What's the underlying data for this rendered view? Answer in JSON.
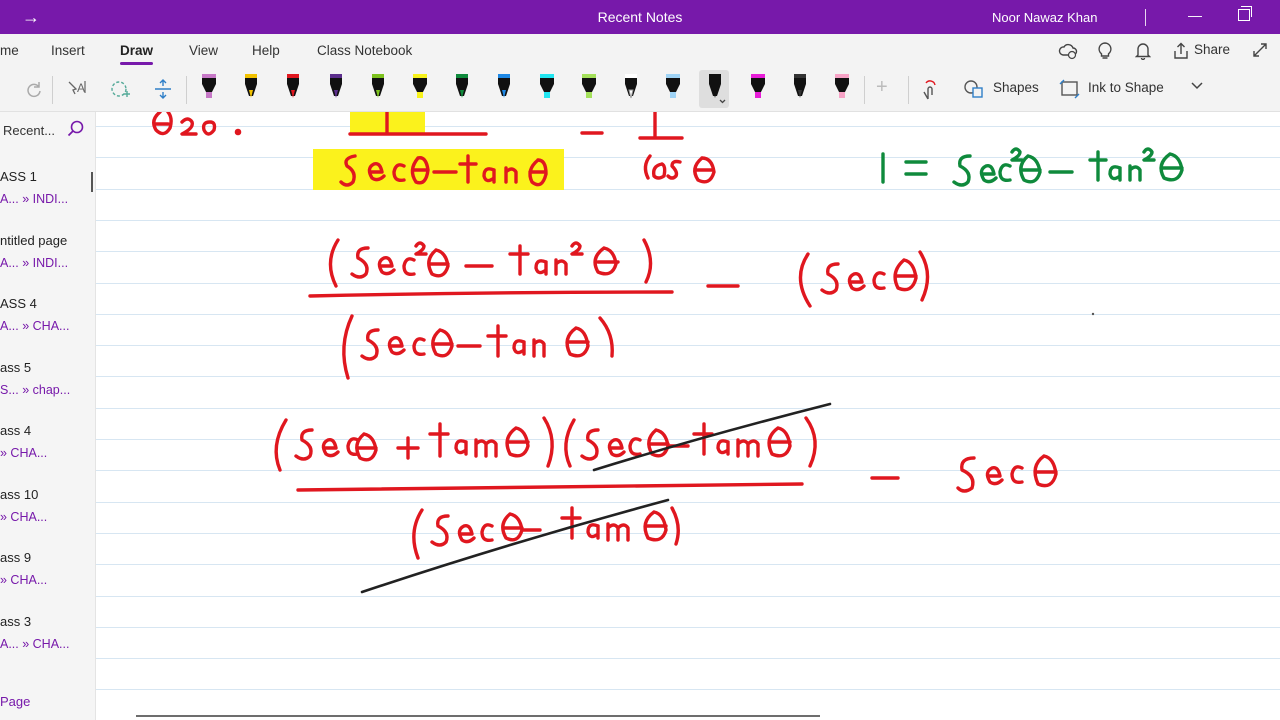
{
  "window": {
    "title": "Recent Notes",
    "user": "Noor Nawaz Khan"
  },
  "ribbon": {
    "tabs": [
      {
        "label": "me"
      },
      {
        "label": "Insert"
      },
      {
        "label": "Draw"
      },
      {
        "label": "View"
      },
      {
        "label": "Help"
      },
      {
        "label": "Class Notebook"
      }
    ],
    "active_tab": "Draw",
    "share_label": "Share"
  },
  "toolbar": {
    "shapes_label": "Shapes",
    "ink_to_shape_label": "Ink to Shape",
    "pens": [
      {
        "kind": "highlighter",
        "color": "#c678c6"
      },
      {
        "kind": "pen",
        "color": "#f2c200"
      },
      {
        "kind": "pen",
        "color": "#e0171f"
      },
      {
        "kind": "pen",
        "color": "#5b2d8c"
      },
      {
        "kind": "pen",
        "color": "#7dc21e"
      },
      {
        "kind": "highlighter",
        "color": "#f7f21c"
      },
      {
        "kind": "pen",
        "color": "#0f8a3c"
      },
      {
        "kind": "pen",
        "color": "#1e88e5"
      },
      {
        "kind": "highlighter",
        "color": "#22e5f0"
      },
      {
        "kind": "highlighter",
        "color": "#a4e05a"
      },
      {
        "kind": "pen",
        "color": "#ffffff"
      },
      {
        "kind": "highlighter",
        "color": "#9fd3f5"
      },
      {
        "kind": "pen",
        "color": "#111111",
        "selected": true
      },
      {
        "kind": "highlighter",
        "color": "#e81ed8"
      },
      {
        "kind": "pen",
        "color": "#333333"
      },
      {
        "kind": "highlighter",
        "color": "#f7a3c6"
      }
    ]
  },
  "sidebar": {
    "header": "Recent...",
    "items": [
      {
        "name": "ASS 1",
        "location": "A... » INDI..."
      },
      {
        "name": "ntitled page",
        "location": "A... » INDI..."
      },
      {
        "name": "ASS 4",
        "location": "A... » CHA..."
      },
      {
        "name": "ass 5",
        "location": "S... » chap..."
      },
      {
        "name": "ass 4",
        "location": "» CHA..."
      },
      {
        "name": "ass 10",
        "location": "» CHA..."
      },
      {
        "name": "ass 9",
        "location": "» CHA..."
      },
      {
        "name": "ass 3",
        "location": "A... » CHA..."
      }
    ],
    "add_page": "Page"
  },
  "colors": {
    "accent": "#7719aa",
    "ink_red": "#e0171f",
    "ink_green": "#0f8a3c",
    "ink_black": "#222222",
    "highlight_yellow": "#fbf21c"
  }
}
